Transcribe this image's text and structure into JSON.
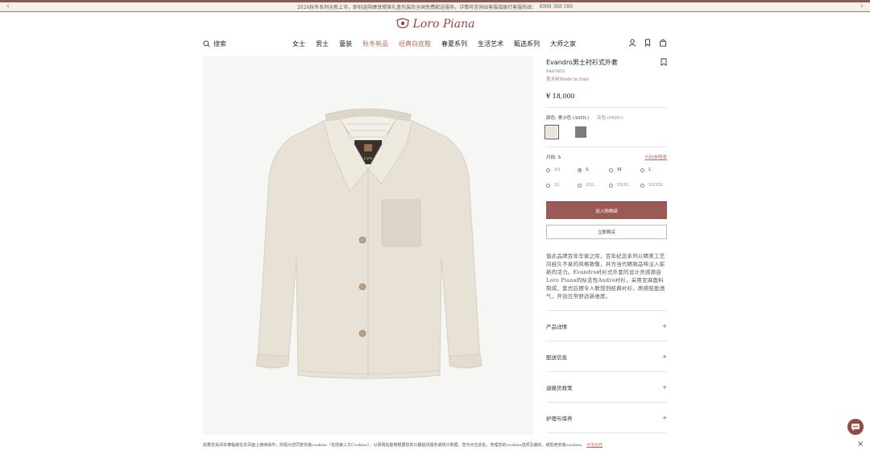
{
  "announcement": {
    "text": "2024秋冬系列全新上市，即刻选购臻享精美礼盒包装及全国免费配送服务，详情可咨询线客服或拨打客服热线：",
    "phone": "4008 368 580"
  },
  "brand": {
    "name": "Loro Piana"
  },
  "nav": {
    "search_label": "搜索",
    "menu": [
      "女士",
      "男士",
      "童装",
      "秋冬新品",
      "经典白底鞋",
      "春夏系列",
      "生活艺术",
      "甄选系列",
      "大师之家"
    ]
  },
  "product": {
    "title": "Evandro男士衬衫式外套",
    "sku": "FAO7653",
    "origin": "意大利Made in Italy",
    "price": "¥ 18,000",
    "color_label": "颜色: 拿沙色 (A0HL)",
    "color_alt": "灰色 (F6PC)",
    "size_label": "尺码:  S",
    "size_guide": "尺码参照表",
    "sizes": [
      "XS",
      "S",
      "M",
      "L",
      "XL",
      "XXL",
      "XXXL",
      "XXXXL"
    ],
    "add_to_cart": "加入购物袋",
    "buy_now": "立即购买",
    "description": "值此品牌百年华诞之际，百年纪念系列以精美工艺向经久不衰的风格致敬，并为当代精致品味注入崭新的活力。Evandro衬衫式外套的设计灵感源自Loro Piana的标志性André衬衫，采用亚麻面料制成，套式后摆令人联想到经典衬衫，质感轻盈透气，开创日常舒适新维度。",
    "accordion": [
      "产品详情",
      "配送信息",
      "退换货政策",
      "护理与保养"
    ]
  },
  "cookie": {
    "text": "如果您关闭本横幅或在本页面上继续操作，则视为您同意安装cookies（包括第三方Cookies），以便网站能够根据您的兴趣提供服务或统计数据。您可点击此处，管理您的cookies选项及偏好，或拒绝安装cookies。",
    "link": "点击此处"
  },
  "colors": {
    "brand": "#9a3f3b",
    "accent": "#b46e62",
    "cart_button": "#9b5a55",
    "jacket": "#e8e2d6",
    "swatch_beige": "#eae4d8",
    "swatch_grey": "#7b7b78"
  }
}
